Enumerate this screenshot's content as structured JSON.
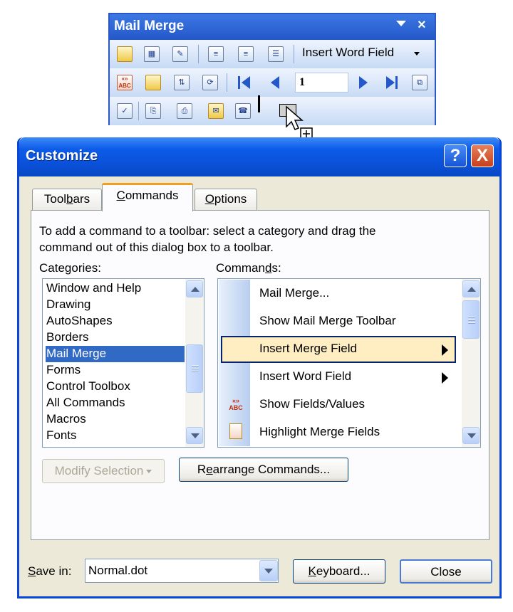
{
  "toolbar": {
    "title": "Mail Merge",
    "insert_word_field": "Insert Word Field",
    "record_number": "1",
    "row1_icons": [
      "main-document-setup-icon",
      "open-data-source-icon",
      "recipients-icon",
      "address-block-icon",
      "greeting-line-icon",
      "insert-merge-fields-icon"
    ],
    "row2_icons": [
      "view-merged-data-icon",
      "highlight-merge-fields-icon",
      "match-fields-icon",
      "propagate-labels-icon",
      "first-record-icon",
      "previous-record-icon",
      "next-record-icon",
      "last-record-icon",
      "find-entry-icon"
    ],
    "row3_icons": [
      "check-for-errors-icon",
      "merge-to-new-document-icon",
      "merge-to-printer-icon",
      "merge-to-email-icon",
      "merge-to-fax-icon"
    ]
  },
  "dialog": {
    "title": "Customize",
    "help_glyph": "?",
    "close_glyph": "X",
    "tabs": [
      {
        "label_pre": "Tool",
        "label_u": "b",
        "label_post": "ars"
      },
      {
        "label_pre": "",
        "label_u": "C",
        "label_post": "ommands"
      },
      {
        "label_pre": "",
        "label_u": "O",
        "label_post": "ptions"
      }
    ],
    "instruction_line1": "To add a command to a toolbar: select a category and drag the",
    "instruction_line2": "command out of this dialog box to a toolbar.",
    "categories_label_pre": "Cate",
    "categories_label_u": "g",
    "categories_label_post": "ories:",
    "commands_label_pre": "Comman",
    "commands_label_u": "d",
    "commands_label_post": "s:",
    "categories": [
      "Window and Help",
      "Drawing",
      "AutoShapes",
      "Borders",
      "Mail Merge",
      "Forms",
      "Control Toolbox",
      "All Commands",
      "Macros",
      "Fonts"
    ],
    "selected_category": "Mail Merge",
    "commands": [
      {
        "label": "Mail Merge...",
        "icon": ""
      },
      {
        "label": "Show Mail Merge Toolbar",
        "icon": ""
      },
      {
        "label": "Insert Merge Field",
        "icon": ""
      },
      {
        "label": "Insert Word Field",
        "icon": ""
      },
      {
        "label": "Show Fields/Values",
        "icon": "view-merged-data-icon",
        "icon_text": "«» ABC"
      },
      {
        "label": "Highlight Merge Fields",
        "icon": "highlight-merge-fields-icon"
      }
    ],
    "selected_command": "Insert Merge Field",
    "modify_selection": "Modify Selection",
    "rearrange_pre": "R",
    "rearrange_u": "e",
    "rearrange_post": "arrange Commands...",
    "save_in_label_u": "S",
    "save_in_label_post": "ave in:",
    "save_in_value": "Normal.dot",
    "keyboard_u": "K",
    "keyboard_post": "eyboard...",
    "close_button": "Close"
  },
  "colors": {
    "title_bar": "#0a4fd6",
    "selection": "#316ac5",
    "menu_highlight": "#ffeec2",
    "toolbar_title": "#2457c8"
  }
}
